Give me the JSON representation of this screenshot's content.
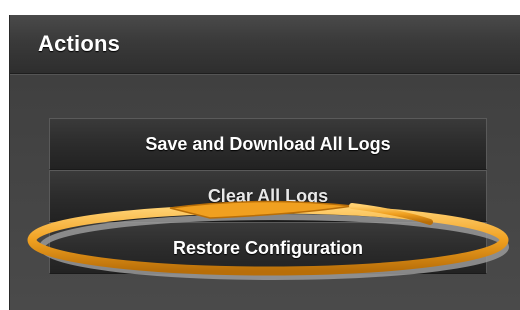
{
  "panel": {
    "title": "Actions"
  },
  "buttons": {
    "save_logs_label": "Save and Download All Logs",
    "clear_logs_label": "Clear All Logs",
    "restore_config_label": "Restore Configuration"
  },
  "colors": {
    "panel_background": "#404040",
    "button_background": "#2c2c2c",
    "highlight_ring": "#f0a020"
  }
}
